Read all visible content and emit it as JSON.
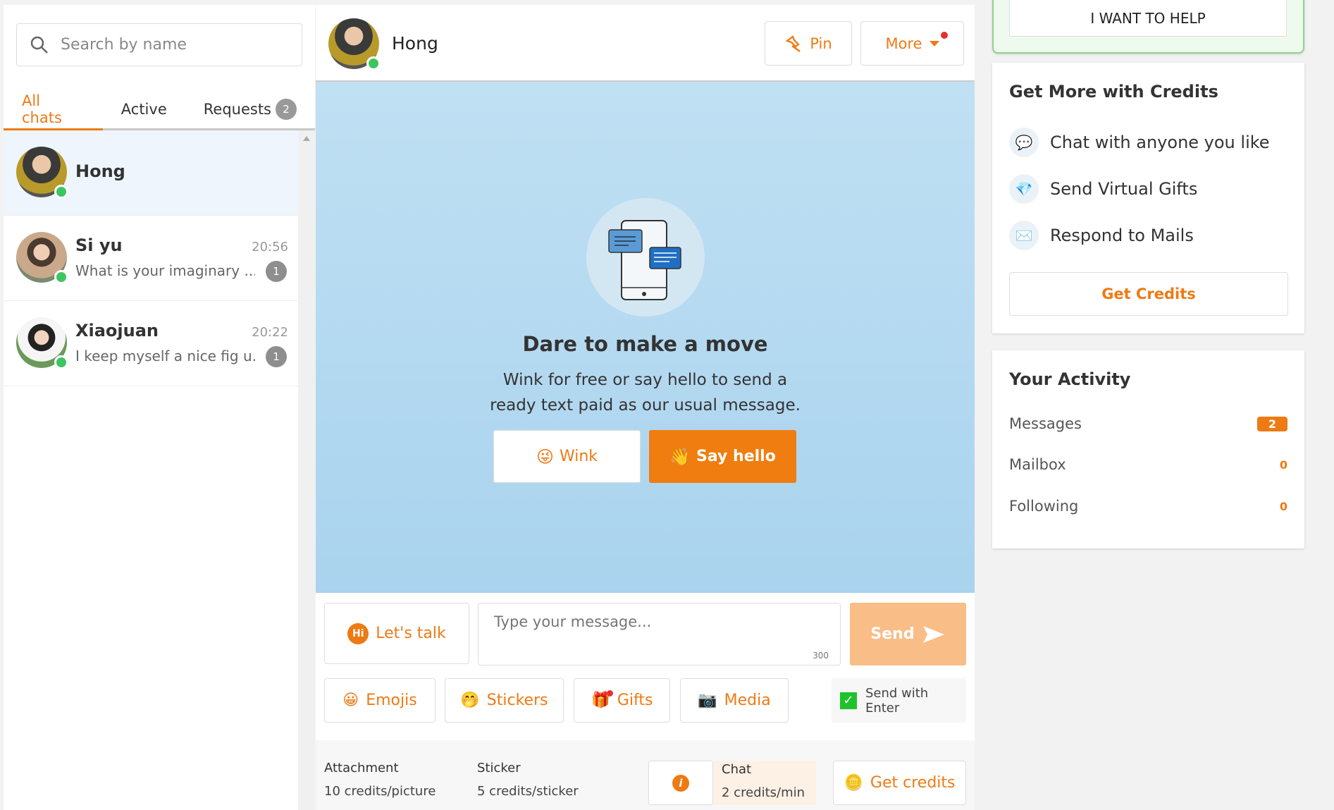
{
  "sidebar": {
    "search_placeholder": "Search by name",
    "tabs": [
      {
        "label": "All chats"
      },
      {
        "label": "Active"
      },
      {
        "label": "Requests",
        "badge": "2"
      }
    ],
    "chats": [
      {
        "name": "Hong",
        "time": "",
        "preview": "",
        "unread": ""
      },
      {
        "name": "Si yu",
        "time": "20:56",
        "preview": "What is your imaginary ...",
        "unread": "1"
      },
      {
        "name": "Xiaojuan",
        "time": "20:22",
        "preview": "I keep myself a nice fig u...",
        "unread": "1"
      }
    ]
  },
  "header": {
    "name": "Hong",
    "pin_label": "Pin",
    "more_label": "More"
  },
  "empty_state": {
    "title": "Dare to make a move",
    "line1": "Wink for free or say hello to send a",
    "line2": "ready text paid as our usual message.",
    "wink_label": "Wink",
    "hello_label": "Say hello"
  },
  "composer": {
    "lets_talk": "Let's talk",
    "placeholder": "Type your message...",
    "char_limit": "300",
    "send_label": "Send",
    "emojis": "Emojis",
    "stickers": "Stickers",
    "gifts": "Gifts",
    "media": "Media",
    "send_with_enter": "Send with Enter",
    "send_with_enter_checked": true
  },
  "pricing": {
    "attachment_label": "Attachment",
    "attachment_value": "10 credits/picture",
    "sticker_label": "Sticker",
    "sticker_value": "5 credits/sticker",
    "chat_label": "Chat",
    "chat_value": "2 credits/min",
    "get_credits": "Get credits"
  },
  "right": {
    "help_button": "I WANT TO HELP",
    "credits_title": "Get More with Credits",
    "features": [
      {
        "icon": "chat-bubble-icon",
        "label": "Chat with anyone you like"
      },
      {
        "icon": "diamond-icon",
        "label": "Send Virtual Gifts"
      },
      {
        "icon": "envelope-icon",
        "label": "Respond to Mails"
      }
    ],
    "get_credits": "Get Credits",
    "activity_title": "Your Activity",
    "activity": [
      {
        "label": "Messages",
        "value": "2"
      },
      {
        "label": "Mailbox",
        "value": "0"
      },
      {
        "label": "Following",
        "value": "0"
      }
    ]
  },
  "colors": {
    "accent": "#ee7a14",
    "online": "#3cc561",
    "chat_bg": "#b5daf0",
    "help_border": "#8fd38f"
  }
}
